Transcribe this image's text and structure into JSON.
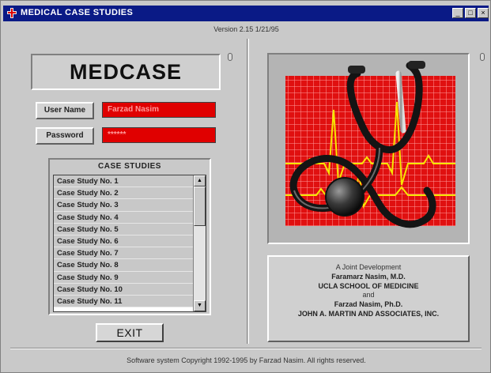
{
  "window": {
    "title": "MEDICAL CASE STUDIES",
    "minimize": "_",
    "maximize": "□",
    "close": "×"
  },
  "version": "Version 2.15  1/21/95",
  "logo": "MEDCASE",
  "login": {
    "username_label": "User Name",
    "username_value": "Farzad Nasim",
    "password_label": "Password",
    "password_value": "******"
  },
  "case_studies": {
    "header": "CASE STUDIES",
    "items": [
      "Case Study No. 1",
      "Case Study No. 2",
      "Case Study No. 3",
      "Case Study No. 4",
      "Case Study No. 5",
      "Case Study No. 6",
      "Case Study No. 7",
      "Case Study No. 8",
      "Case Study No. 9",
      "Case Study No. 10",
      "Case Study No. 11"
    ]
  },
  "exit_label": "EXIT",
  "credits": {
    "heading": "A Joint Development",
    "line1": "Faramarz Nasim, M.D.",
    "line2": "UCLA SCHOOL OF MEDICINE",
    "and": "and",
    "line3": "Farzad Nasim, Ph.D.",
    "line4": "JOHN A. MARTIN AND ASSOCIATES, INC."
  },
  "copyright": "Software system Copyright 1992-1995 by Farzad Nasim. All rights reserved.",
  "colors": {
    "titlebar": "#0a1a86",
    "field_red": "#e00000",
    "chart_red": "#e01010",
    "ekg_yellow": "#f7e600",
    "face": "#c9c9c9"
  },
  "icons": [
    "app-icon",
    "stethoscope-icon",
    "ekg-grid-image"
  ]
}
